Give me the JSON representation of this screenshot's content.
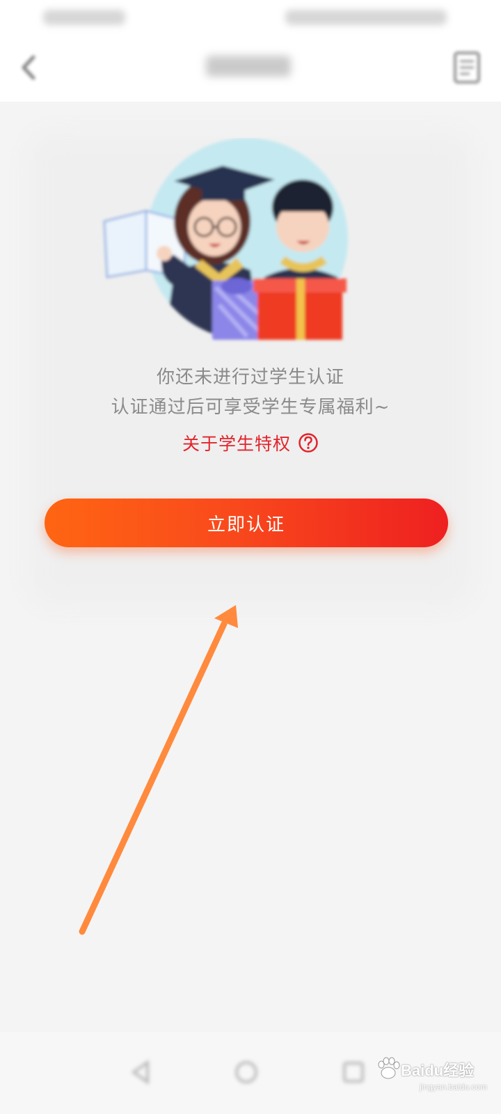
{
  "info": {
    "line1": "你还未进行过学生认证",
    "line2": "认证通过后可享受学生专属福利~",
    "privilege_link": "关于学生特权"
  },
  "cta": {
    "label": "立即认证"
  },
  "watermark": {
    "logo_text": "Baidu经验",
    "url": "jingyan.baidu.com"
  },
  "colors": {
    "accent_red": "#e2232b",
    "button_gradient_start": "#ff6512",
    "button_gradient_end": "#ee2020",
    "annotation_arrow": "#ff8a3d",
    "background": "#f4f4f4"
  },
  "icons": {
    "nav_left": "back-arrow-icon",
    "nav_right": "document-icon",
    "help": "question-circle-icon",
    "bottom_nav": [
      "back-icon",
      "home-icon",
      "recent-apps-icon"
    ]
  }
}
